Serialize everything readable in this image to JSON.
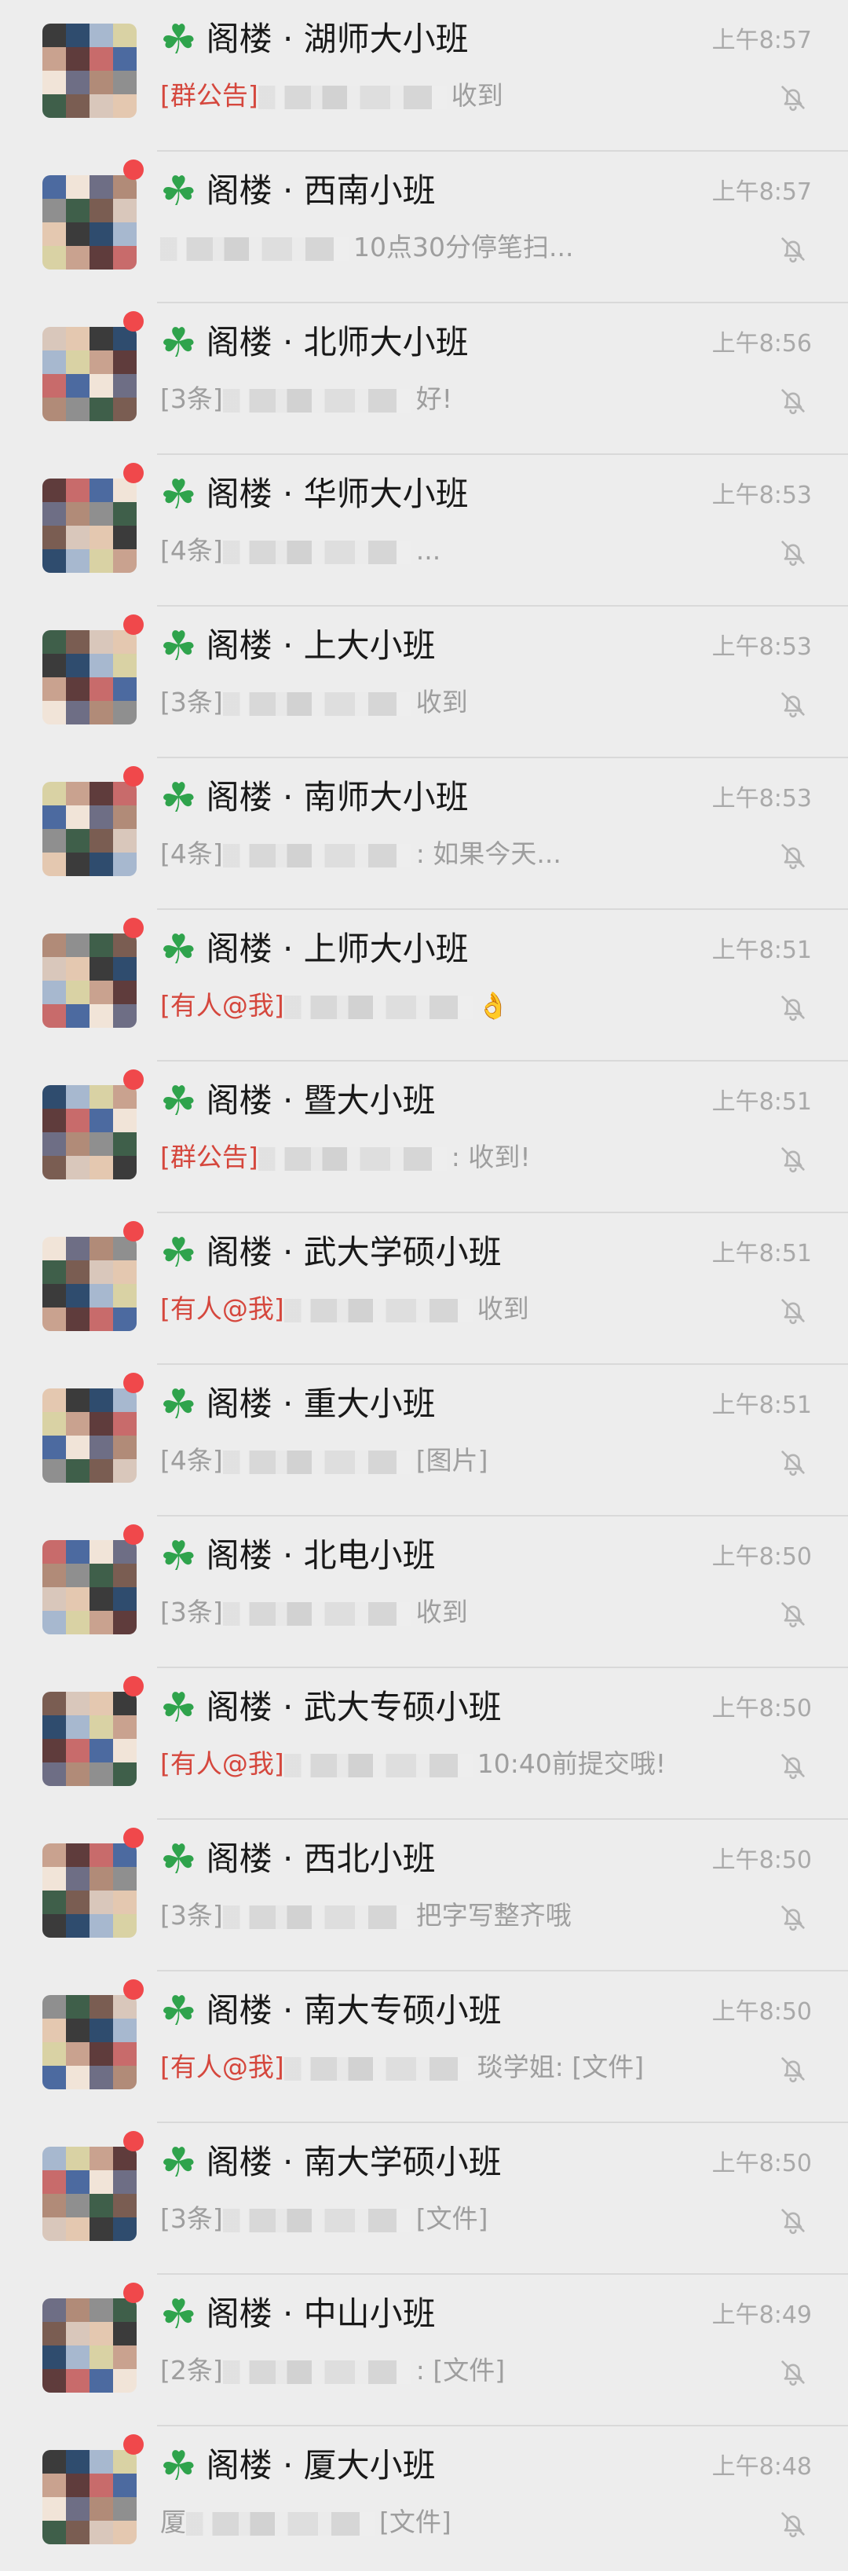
{
  "chats": [
    {
      "title": "阁楼 · 湖师大小班",
      "preview_tag": "[群公告]",
      "preview_text": "收到",
      "time": "上午8:57",
      "unread_dot": false
    },
    {
      "title": "阁楼 · 西南小班",
      "preview_tag": "",
      "preview_text": "10点30分停笔扫...",
      "time": "上午8:57",
      "unread_dot": true
    },
    {
      "title": "阁楼 · 北师大小班",
      "preview_tag": "[3条]",
      "preview_text": "好!",
      "time": "上午8:56",
      "unread_dot": true
    },
    {
      "title": "阁楼 · 华师大小班",
      "preview_tag": "[4条]",
      "preview_text": "...",
      "time": "上午8:53",
      "unread_dot": true
    },
    {
      "title": "阁楼 · 上大小班",
      "preview_tag": "[3条]",
      "preview_text": "收到",
      "time": "上午8:53",
      "unread_dot": true
    },
    {
      "title": "阁楼 · 南师大小班",
      "preview_tag": "[4条]",
      "preview_text": ": 如果今天...",
      "time": "上午8:53",
      "unread_dot": true
    },
    {
      "title": "阁楼 · 上师大小班",
      "preview_tag": "[有人@我]",
      "preview_text": "👌",
      "time": "上午8:51",
      "unread_dot": true
    },
    {
      "title": "阁楼 · 暨大小班",
      "preview_tag": "[群公告]",
      "preview_text": ": 收到!",
      "time": "上午8:51",
      "unread_dot": true
    },
    {
      "title": "阁楼 · 武大学硕小班",
      "preview_tag": "[有人@我]",
      "preview_text": "收到",
      "time": "上午8:51",
      "unread_dot": true
    },
    {
      "title": "阁楼 · 重大小班",
      "preview_tag": "[4条]",
      "preview_text": "[图片]",
      "time": "上午8:51",
      "unread_dot": true
    },
    {
      "title": "阁楼 · 北电小班",
      "preview_tag": "[3条]",
      "preview_text": "收到",
      "time": "上午8:50",
      "unread_dot": true
    },
    {
      "title": "阁楼 · 武大专硕小班",
      "preview_tag": "[有人@我]",
      "preview_text": "10:40前提交哦!",
      "time": "上午8:50",
      "unread_dot": true
    },
    {
      "title": "阁楼 · 西北小班",
      "preview_tag": "[3条]",
      "preview_text": "把字写整齐哦",
      "time": "上午8:50",
      "unread_dot": true
    },
    {
      "title": "阁楼 · 南大专硕小班",
      "preview_tag": "[有人@我]",
      "preview_text": "琰学姐: [文件]",
      "time": "上午8:50",
      "unread_dot": true
    },
    {
      "title": "阁楼 · 南大学硕小班",
      "preview_tag": "[3条]",
      "preview_text": "[文件]",
      "time": "上午8:50",
      "unread_dot": true
    },
    {
      "title": "阁楼 · 中山小班",
      "preview_tag": "[2条]",
      "preview_text": ": [文件]",
      "time": "上午8:49",
      "unread_dot": true
    },
    {
      "title": "阁楼 · 厦大小班",
      "preview_tag": "厦",
      "preview_text": "[文件]",
      "time": "上午8:48",
      "unread_dot": true
    }
  ],
  "icons": {
    "clover": "clover-icon",
    "mute": "bell-off-icon"
  },
  "colors": {
    "background": "#ededed",
    "title": "#191919",
    "preview": "#9e9e9e",
    "highlight_tag": "#d5473d",
    "unread_dot": "#f0484b",
    "clover": "#2fa34c"
  }
}
